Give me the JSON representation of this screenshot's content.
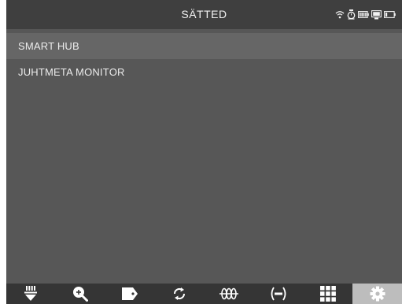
{
  "header": {
    "title": "SÄTTED",
    "status_icons": [
      "wifi-icon",
      "alarm-clock-icon",
      "battery-icon",
      "monitor-icon",
      "device-battery-icon"
    ]
  },
  "list": {
    "items": [
      {
        "label": "SMART HUB",
        "highlighted": true
      },
      {
        "label": "JUHTMETA MONITOR",
        "highlighted": false
      }
    ]
  },
  "toolbar": {
    "buttons": [
      {
        "icon": "download-icon"
      },
      {
        "icon": "zoom-in-icon"
      },
      {
        "icon": "tag-icon"
      },
      {
        "icon": "refresh-icon"
      },
      {
        "icon": "signal-wave-icon"
      },
      {
        "icon": "wireless-icon"
      },
      {
        "icon": "grid-icon"
      },
      {
        "icon": "settings-gear-icon",
        "active": true
      }
    ]
  },
  "colors": {
    "background": "#575757",
    "titlebar": "#3f3f3f",
    "toolbar": "#353535",
    "active_tab": "#bdbdbd",
    "highlight_row": "#666666"
  }
}
